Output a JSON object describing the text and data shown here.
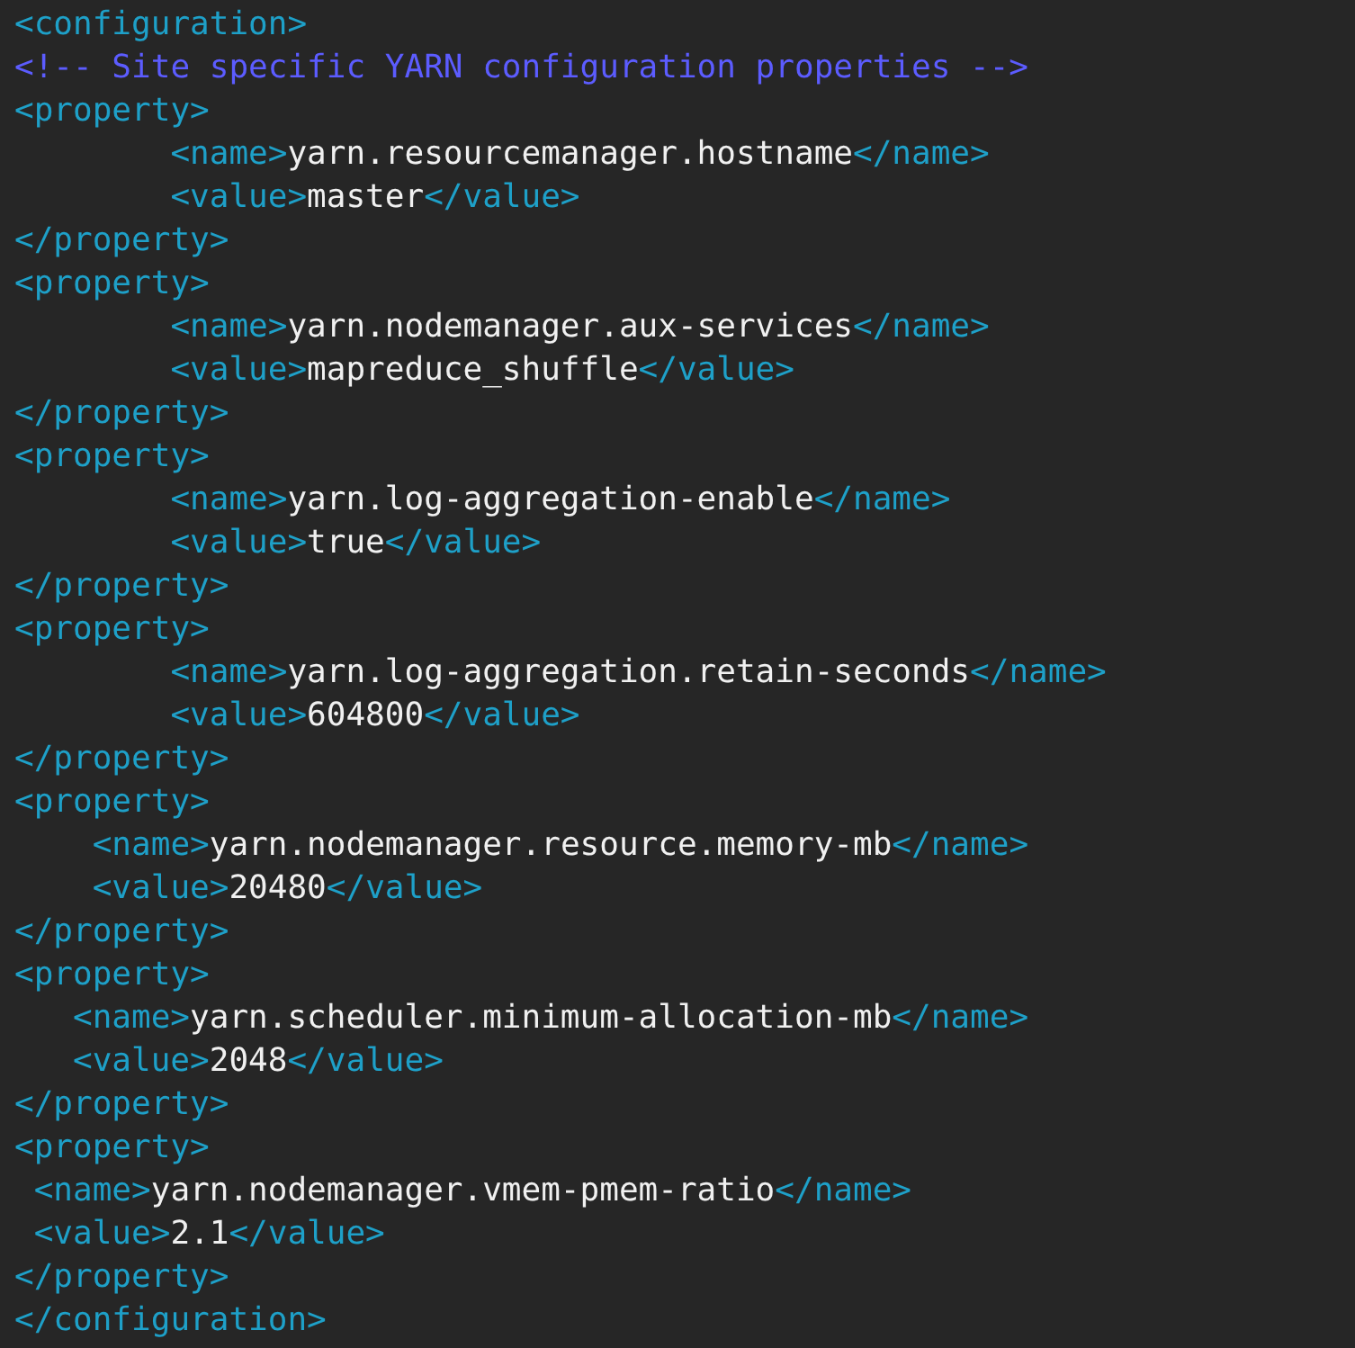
{
  "lines": [
    {
      "kind": "tag",
      "text": "<configuration>"
    },
    {
      "kind": "comment",
      "text": "<!-- Site specific YARN configuration properties -->"
    },
    {
      "kind": "tag",
      "text": "<property>"
    },
    {
      "kind": "tabbed",
      "open": "<name>",
      "value": "yarn.resourcemanager.hostname",
      "close": "</name>"
    },
    {
      "kind": "tabbed",
      "open": "<value>",
      "value": "master",
      "close": "</value>"
    },
    {
      "kind": "tag",
      "text": "</property>"
    },
    {
      "kind": "tag",
      "text": "<property>"
    },
    {
      "kind": "tabbed",
      "open": "<name>",
      "value": "yarn.nodemanager.aux-services",
      "close": "</name>"
    },
    {
      "kind": "tabbed",
      "open": "<value>",
      "value": "mapreduce_shuffle",
      "close": "</value>"
    },
    {
      "kind": "tag",
      "text": "</property>"
    },
    {
      "kind": "tag",
      "text": "<property>"
    },
    {
      "kind": "tabbed",
      "open": "<name>",
      "value": "yarn.log-aggregation-enable",
      "close": "</name>"
    },
    {
      "kind": "tabbed",
      "open": "<value>",
      "value": "true",
      "close": "</value>"
    },
    {
      "kind": "tag",
      "text": "</property>"
    },
    {
      "kind": "tag",
      "text": "<property>"
    },
    {
      "kind": "tabbed",
      "open": "<name>",
      "value": "yarn.log-aggregation.retain-seconds",
      "close": "</name>"
    },
    {
      "kind": "tabbed",
      "open": "<value>",
      "value": "604800",
      "close": "</value>"
    },
    {
      "kind": "tag",
      "text": "</property>"
    },
    {
      "kind": "tag",
      "text": "<property>"
    },
    {
      "kind": "indented",
      "open": "<name>",
      "value": "yarn.nodemanager.resource.memory-mb",
      "close": "</name>"
    },
    {
      "kind": "indented",
      "open": "<value>",
      "value": "20480",
      "close": "</value>"
    },
    {
      "kind": "tag",
      "text": "</property>"
    },
    {
      "kind": "tag",
      "text": "<property>"
    },
    {
      "kind": "shallow",
      "open": "<name>",
      "value": "yarn.scheduler.minimum-allocation-mb",
      "close": "</name>"
    },
    {
      "kind": "shallow",
      "open": "<value>",
      "value": "2048",
      "close": "</value>"
    },
    {
      "kind": "tag",
      "text": "</property>"
    },
    {
      "kind": "tag",
      "text": "<property>"
    },
    {
      "kind": "slight",
      "open": "<name>",
      "value": "yarn.nodemanager.vmem-pmem-ratio",
      "close": "</name>"
    },
    {
      "kind": "slight",
      "open": "<value>",
      "value": "2.1",
      "close": "</value>"
    },
    {
      "kind": "tag",
      "text": "</property>"
    },
    {
      "kind": "tag",
      "text": "</configuration>"
    }
  ]
}
